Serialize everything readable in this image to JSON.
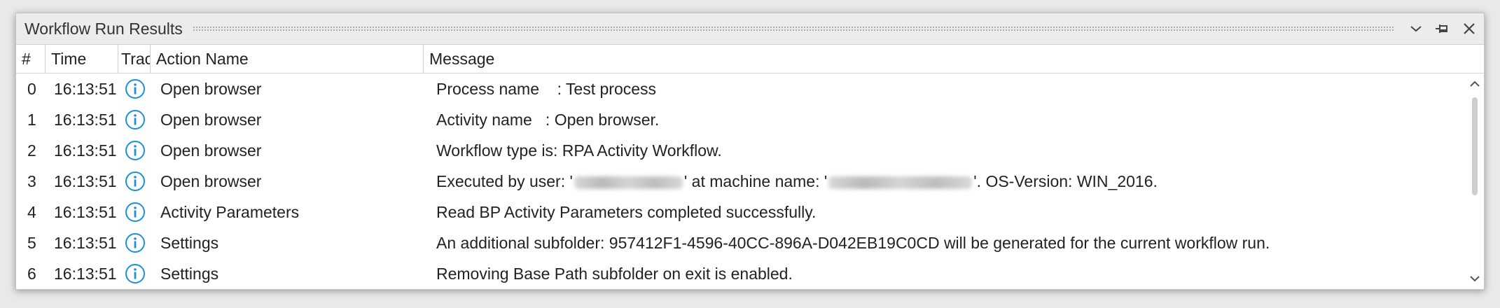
{
  "window": {
    "title": "Workflow Run Results",
    "accent_color": "#1e90d8"
  },
  "columns": [
    {
      "key": "num",
      "label": "#"
    },
    {
      "key": "time",
      "label": "Time"
    },
    {
      "key": "trace",
      "label": "Trac"
    },
    {
      "key": "action",
      "label": "Action Name"
    },
    {
      "key": "message",
      "label": "Message"
    }
  ],
  "rows": [
    {
      "num": "0",
      "time": "16:13:51",
      "icon": "info-icon",
      "action": "Open browser",
      "message": "Process name    : Test process"
    },
    {
      "num": "1",
      "time": "16:13:51",
      "icon": "info-icon",
      "action": "Open browser",
      "message": "Activity name   : Open browser."
    },
    {
      "num": "2",
      "time": "16:13:51",
      "icon": "info-icon",
      "action": "Open browser",
      "message": "Workflow type is: RPA Activity Workflow."
    },
    {
      "num": "3",
      "time": "16:13:51",
      "icon": "info-icon",
      "action": "Open browser",
      "message_parts": [
        "Executed by user: '",
        "' at machine name: '",
        "'. OS-Version: WIN_2016."
      ]
    },
    {
      "num": "4",
      "time": "16:13:51",
      "icon": "info-icon",
      "action": "Activity Parameters",
      "message": "Read BP Activity Parameters completed successfully."
    },
    {
      "num": "5",
      "time": "16:13:51",
      "icon": "info-icon",
      "action": "Settings",
      "message": "An additional subfolder: 957412F1-4596-40CC-896A-D042EB19C0CD will be generated for the current workflow run."
    },
    {
      "num": "6",
      "time": "16:13:51",
      "icon": "info-icon",
      "action": "Settings",
      "message": "Removing Base Path subfolder on exit is enabled."
    }
  ]
}
